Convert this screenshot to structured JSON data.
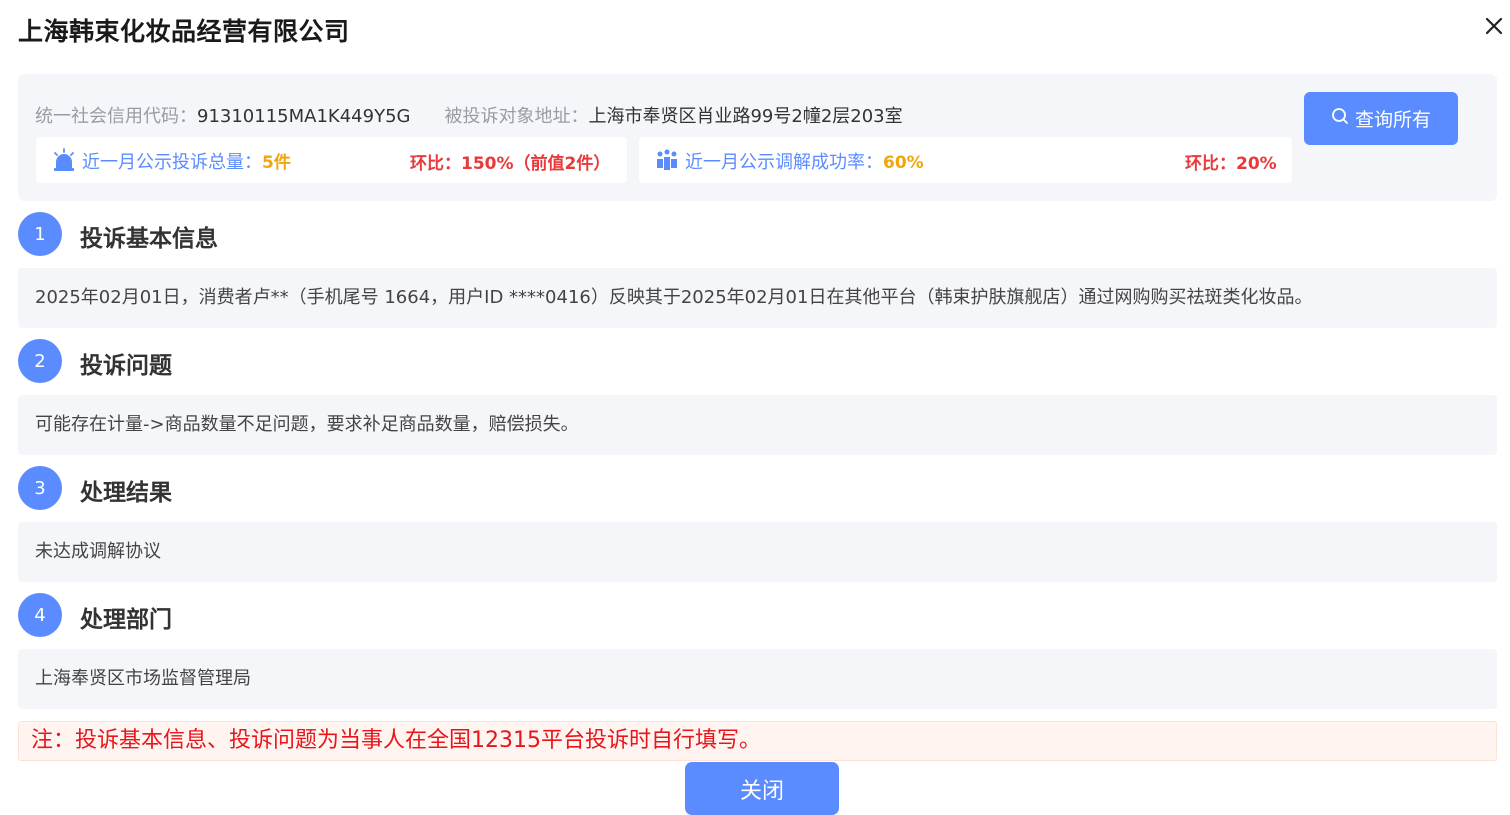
{
  "dialog": {
    "title": "上海韩束化妆品经营有限公司",
    "close_icon": "close-icon"
  },
  "info": {
    "credit_code_label": "统一社会信用代码：",
    "credit_code_value": "91310115MA1K449Y5G",
    "address_label": "被投诉对象地址：",
    "address_value": "上海市奉贤区肖业路99号2幢2层203室",
    "query_button_label": "查询所有",
    "query_icon": "search-icon"
  },
  "stats": {
    "complaints": {
      "icon": "alarm-bell-icon",
      "label": "近一月公示投诉总量：",
      "value": "5件",
      "ratio": "环比：150%（前值2件）"
    },
    "mediation": {
      "icon": "people-icon",
      "label": "近一月公示调解成功率：",
      "value": "60%",
      "ratio": "环比：20%"
    }
  },
  "sections": [
    {
      "number": "1",
      "title": "投诉基本信息",
      "content": "2025年02月01日，消费者卢**（手机尾号 1664，用户ID ****0416）反映其于2025年02月01日在其他平台（韩束护肤旗舰店）通过网购购买祛斑类化妆品。"
    },
    {
      "number": "2",
      "title": "投诉问题",
      "content": "可能存在计量->商品数量不足问题，要求补足商品数量，赔偿损失。"
    },
    {
      "number": "3",
      "title": "处理结果",
      "content": "未达成调解协议"
    },
    {
      "number": "4",
      "title": "处理部门",
      "content": "上海奉贤区市场监督管理局"
    }
  ],
  "note": "注：投诉基本信息、投诉问题为当事人在全国12315平台投诉时自行填写。",
  "footer": {
    "close_button_label": "关闭"
  },
  "colors": {
    "accent": "#5b8cff",
    "highlight": "#f2a60c",
    "alert": "#e8393b",
    "panel_bg": "#f5f6fa"
  }
}
